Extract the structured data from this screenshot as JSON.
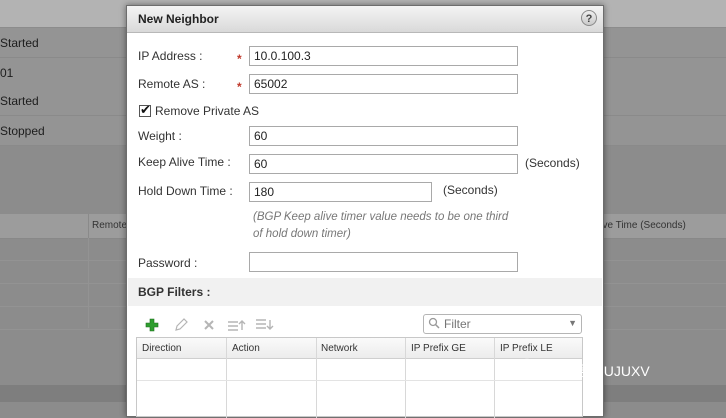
{
  "background": {
    "status_rows": [
      "Started",
      "01",
      "Started",
      "Stopped"
    ],
    "table_headers": [
      "Remote",
      "live Time (Seconds)"
    ]
  },
  "dialog": {
    "title": "New Neighbor",
    "help_glyph": "?",
    "fields": {
      "ip_address": {
        "label": "IP Address :",
        "value": "10.0.100.3",
        "required": true
      },
      "remote_as": {
        "label": "Remote AS :",
        "value": "65002",
        "required": true
      },
      "remove_private_as": {
        "label": "Remove Private AS",
        "checked": true
      },
      "weight": {
        "label": "Weight :",
        "value": "60"
      },
      "keep_alive": {
        "label": "Keep Alive Time :",
        "value": "60",
        "unit": "(Seconds)"
      },
      "hold_down": {
        "label": "Hold Down Time :",
        "value": "180",
        "unit": "(Seconds)"
      },
      "hint": "(BGP Keep alive timer value needs to be one third of hold down timer)",
      "password": {
        "label": "Password :",
        "value": ""
      }
    },
    "bgp_filters": {
      "title": "BGP Filters :",
      "toolbar": [
        "add-icon",
        "edit-icon",
        "delete-icon",
        "move-up-icon",
        "move-down-icon"
      ],
      "filter_placeholder": "Filter",
      "columns": [
        "Direction",
        "Action",
        "Network",
        "IP Prefix GE",
        "IP Prefix LE"
      ],
      "rows": []
    }
  },
  "watermark": "微信号: JUJUXV",
  "colors": {
    "required": "#c0392b",
    "add": "#2e9e2e",
    "overlay": "#8c8c8c"
  }
}
